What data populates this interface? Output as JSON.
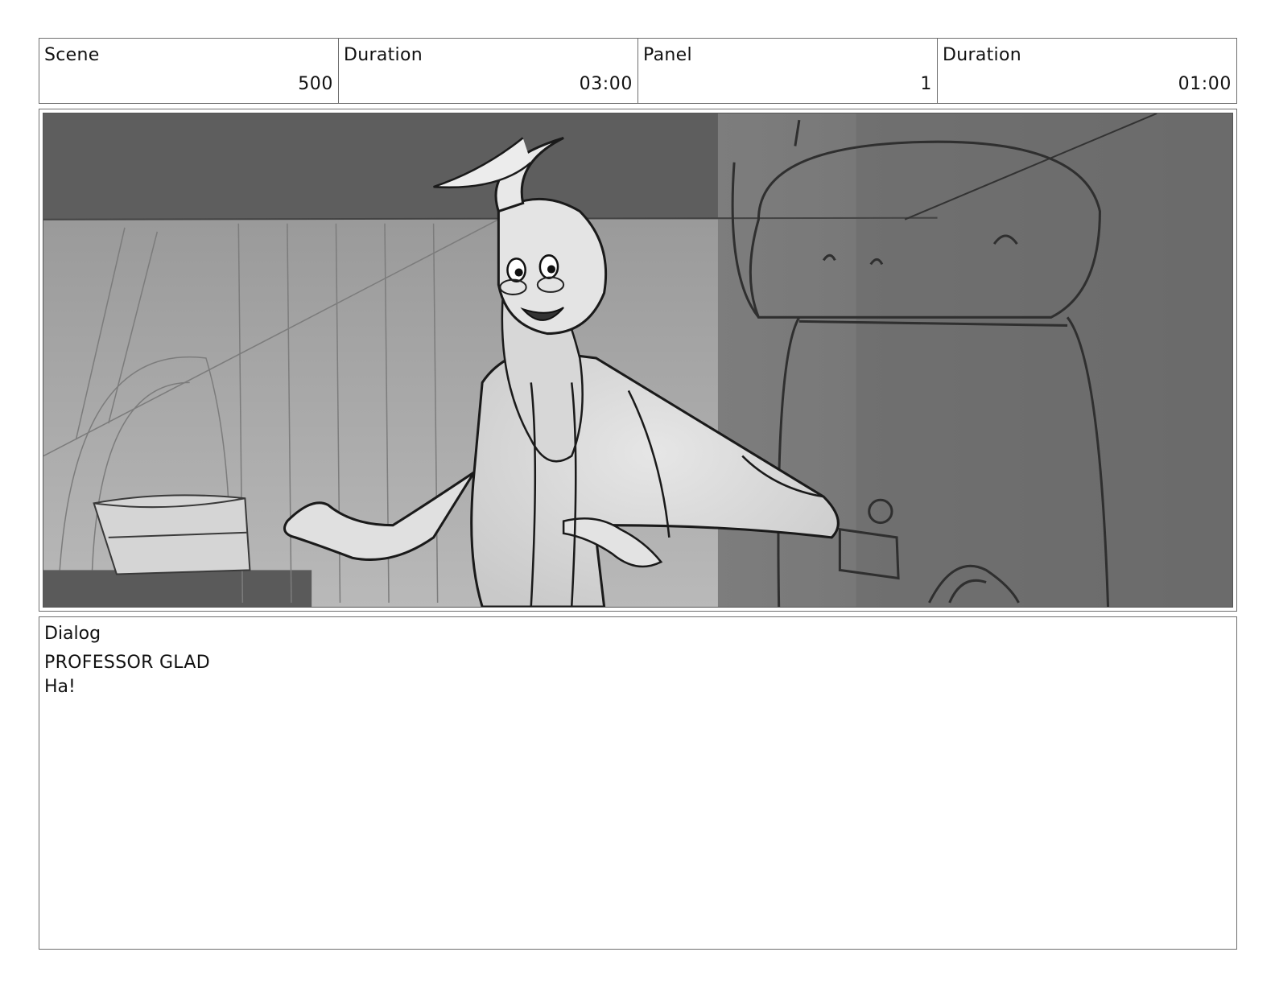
{
  "header": {
    "cells": [
      {
        "label": "Scene",
        "value": "500"
      },
      {
        "label": "Duration",
        "value": "03:00"
      },
      {
        "label": "Panel",
        "value": "1"
      },
      {
        "label": "Duration",
        "value": "01:00"
      }
    ]
  },
  "frame": {
    "icon": "storyboard-sketch-wizard-laughing"
  },
  "dialog": {
    "label": "Dialog",
    "speaker": "PROFESSOR GLAD",
    "line": "Ha!"
  }
}
